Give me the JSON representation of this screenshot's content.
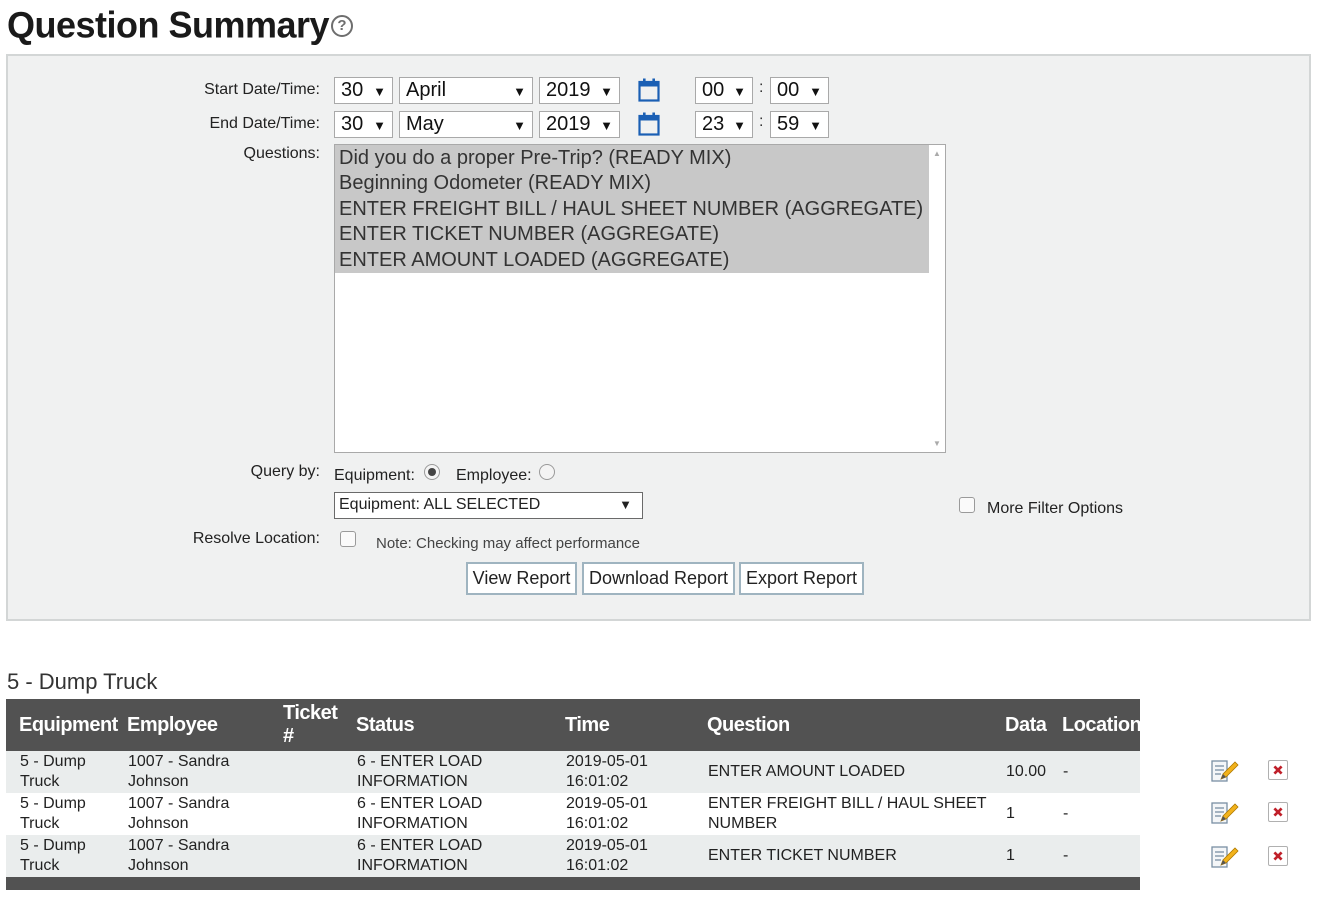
{
  "page": {
    "title": "Question Summary",
    "help_icon": "?"
  },
  "filters": {
    "start_label": "Start Date/Time:",
    "end_label": "End Date/Time:",
    "start": {
      "day": "30",
      "month": "April",
      "year": "2019",
      "hour": "00",
      "minute": "00"
    },
    "end": {
      "day": "30",
      "month": "May",
      "year": "2019",
      "hour": "23",
      "minute": "59"
    },
    "time_separator": ":",
    "questions_label": "Questions:",
    "questions": [
      "Did you do a proper Pre-Trip? (READY MIX)",
      "Beginning Odometer (READY MIX)",
      "ENTER FREIGHT BILL / HAUL SHEET NUMBER (AGGREGATE)",
      "ENTER TICKET NUMBER (AGGREGATE)",
      "ENTER AMOUNT LOADED (AGGREGATE)"
    ],
    "query_by_label": "Query by:",
    "equipment_radio_label": "Equipment:",
    "employee_radio_label": "Employee:",
    "equipment_select": "Equipment: ALL SELECTED",
    "more_filter_label": "More Filter Options",
    "resolve_location_label": "Resolve Location:",
    "resolve_note": "Note: Checking may affect performance",
    "buttons": {
      "view": "View Report",
      "download": "Download Report",
      "export": "Export Report"
    }
  },
  "results": {
    "section_title": "5 - Dump Truck",
    "columns": {
      "equipment": "Equipment",
      "employee": "Employee",
      "ticket_1": "Ticket",
      "ticket_2": "#",
      "status": "Status",
      "time": "Time",
      "question": "Question",
      "data": "Data",
      "location": "Location"
    },
    "rows": [
      {
        "equipment_1": "5 - Dump",
        "equipment_2": "Truck",
        "employee_1": "1007 - Sandra",
        "employee_2": "Johnson",
        "status_1": "6 - ENTER LOAD",
        "status_2": "INFORMATION",
        "time_1": "2019-05-01",
        "time_2": "16:01:02",
        "question_1": "ENTER AMOUNT LOADED",
        "question_2": "",
        "data": "10.00",
        "location": "-"
      },
      {
        "equipment_1": "5 - Dump",
        "equipment_2": "Truck",
        "employee_1": "1007 - Sandra",
        "employee_2": "Johnson",
        "status_1": "6 - ENTER LOAD",
        "status_2": "INFORMATION",
        "time_1": "2019-05-01",
        "time_2": "16:01:02",
        "question_1": "ENTER FREIGHT BILL / HAUL SHEET",
        "question_2": "NUMBER",
        "data": "1",
        "location": "-"
      },
      {
        "equipment_1": "5 - Dump",
        "equipment_2": "Truck",
        "employee_1": "1007 - Sandra",
        "employee_2": "Johnson",
        "status_1": "6 - ENTER LOAD",
        "status_2": "INFORMATION",
        "time_1": "2019-05-01",
        "time_2": "16:01:02",
        "question_1": "ENTER TICKET NUMBER",
        "question_2": "",
        "data": "1",
        "location": "-"
      }
    ]
  },
  "icons": {
    "calendar": "calendar-icon",
    "edit": "edit-icon",
    "delete": "delete-icon",
    "help": "help-icon"
  },
  "colors": {
    "header_bg": "#525252",
    "panel_bg": "#f0f1f1",
    "selected_option": "#c8c8c8",
    "calendar_blue": "#1a5fb4",
    "delete_red": "#c0202a"
  }
}
